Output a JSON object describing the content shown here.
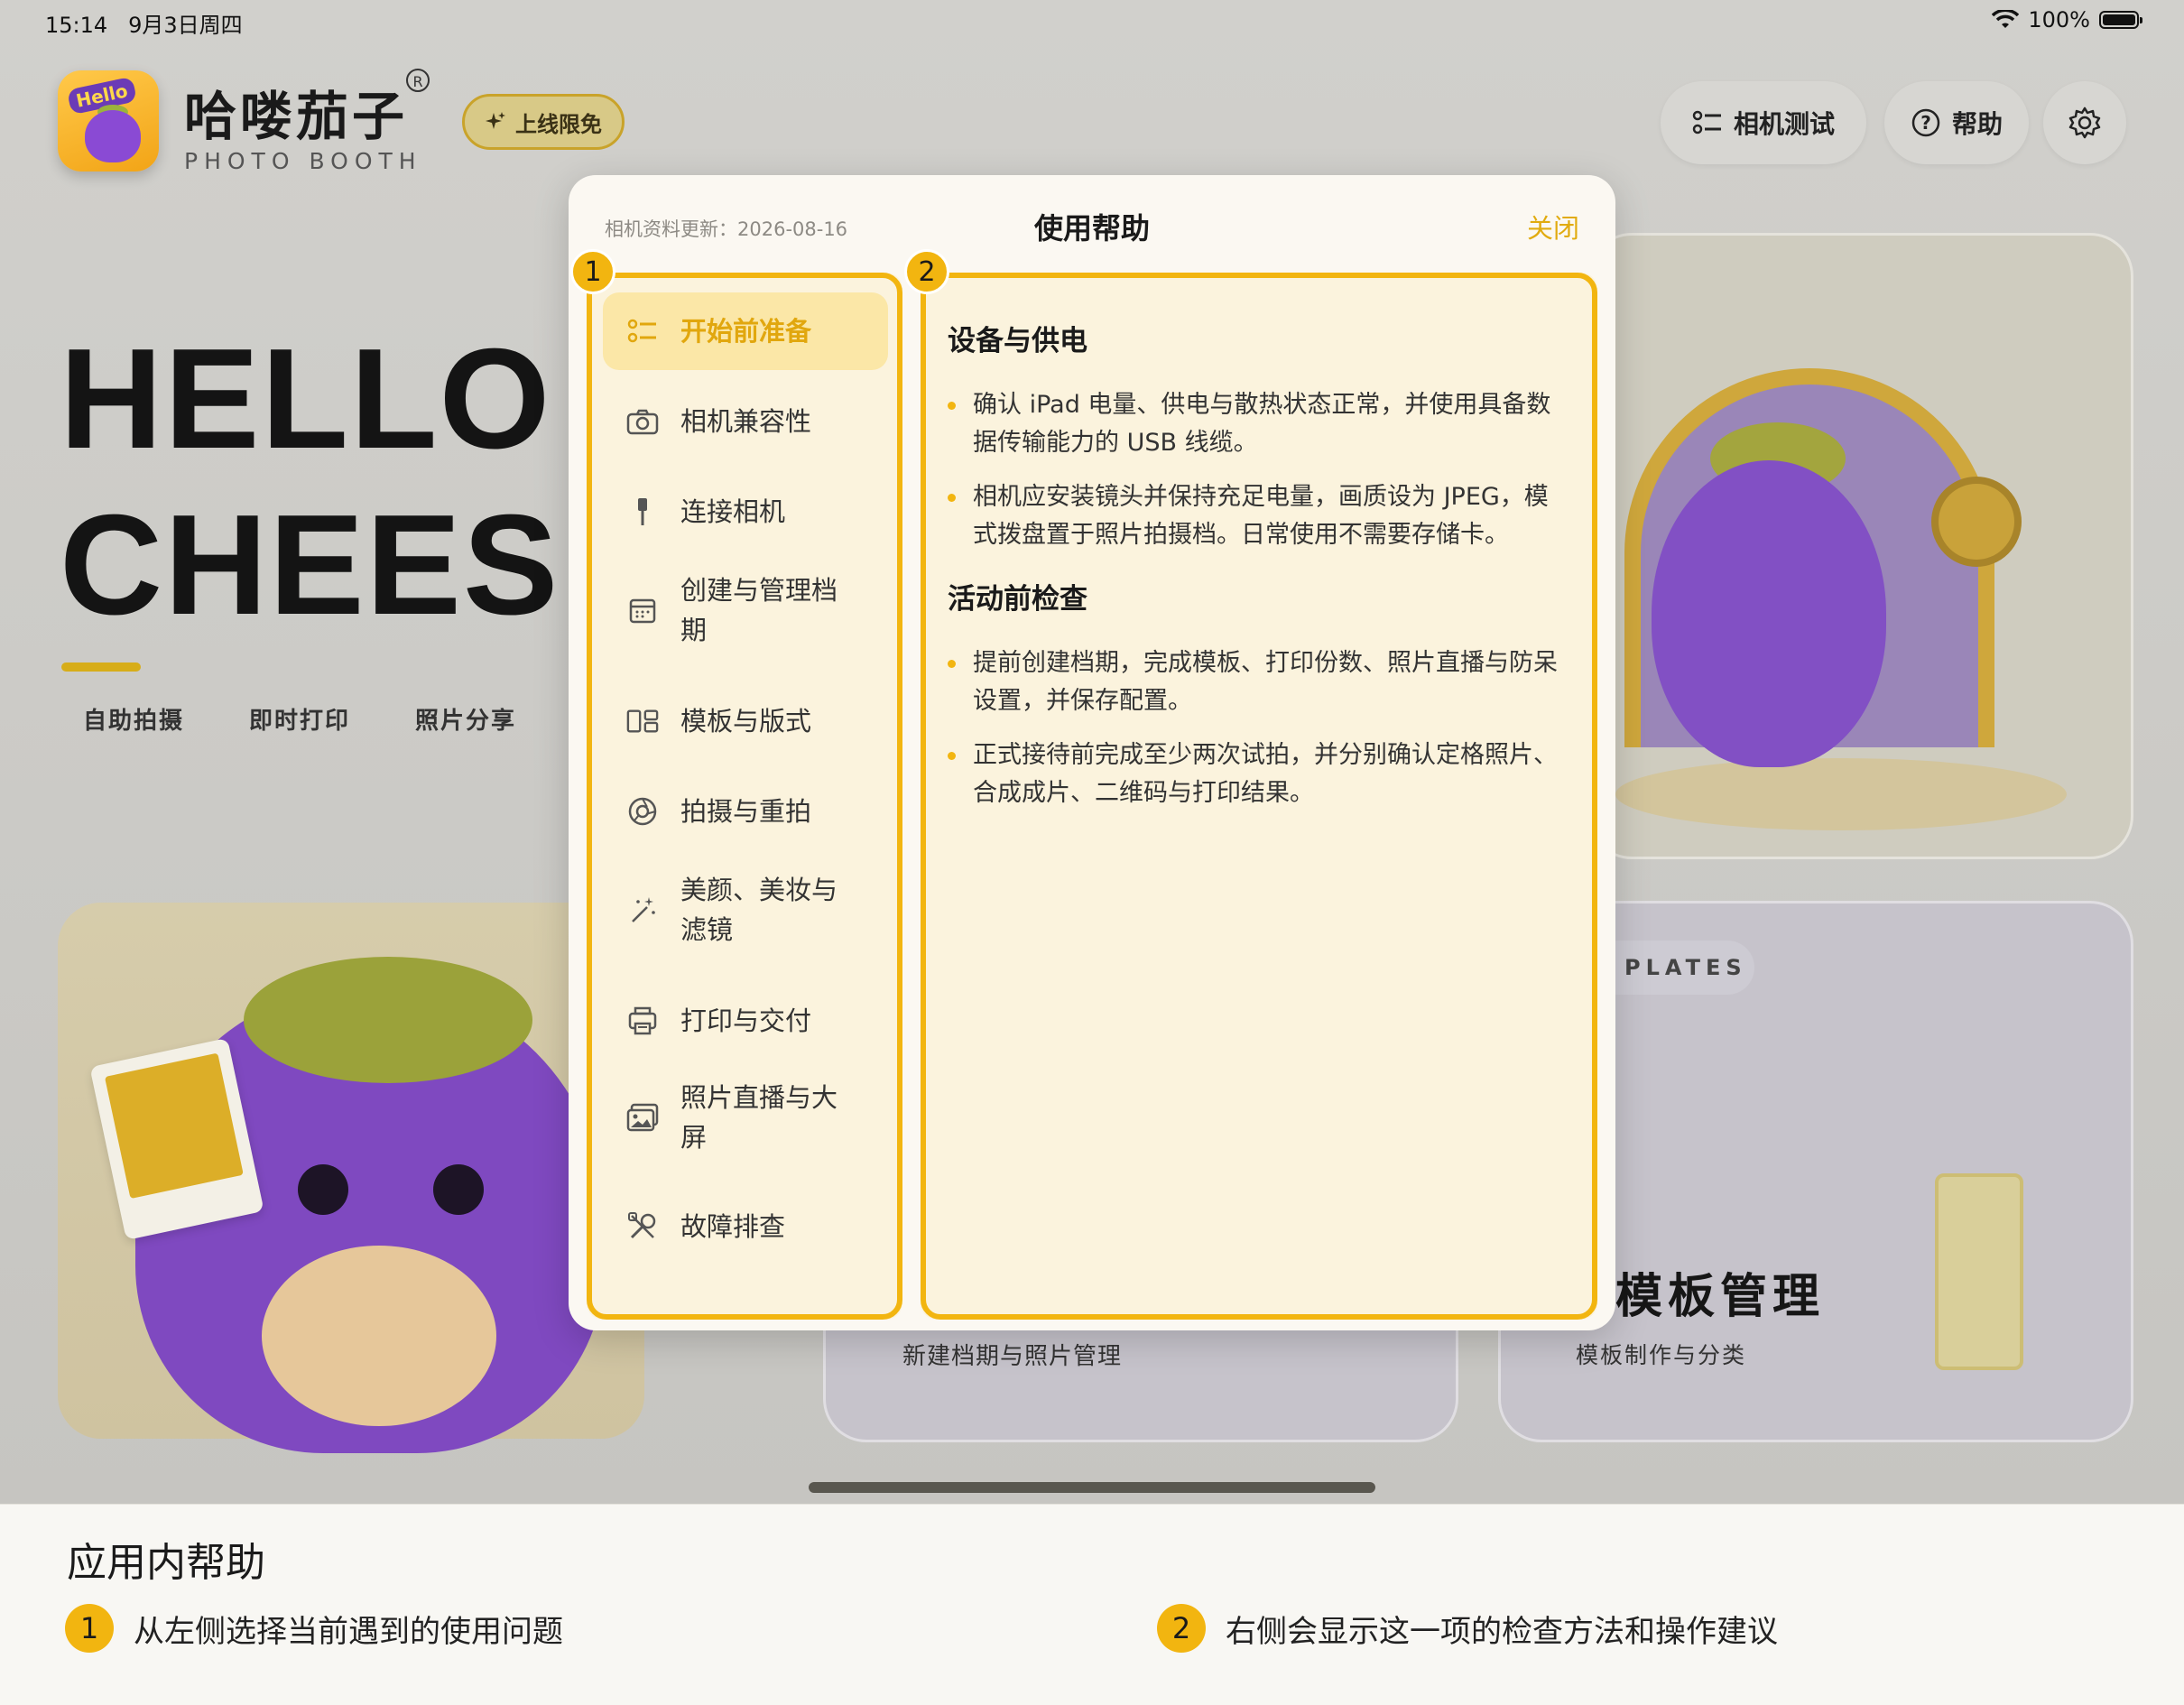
{
  "status_bar": {
    "time": "15:14",
    "date": "9月3日周四",
    "battery": "100%"
  },
  "brand": {
    "logo_text": "Hello",
    "name": "哈喽茄子",
    "registered": "R",
    "tagline": "PHOTO BOOTH",
    "promo": "上线限免"
  },
  "header_buttons": {
    "camera_test": "相机测试",
    "help": "帮助"
  },
  "hero": {
    "line1": "HELLO",
    "line2": "CHEESE",
    "features": [
      "自助拍摄",
      "即时打印",
      "照片分享"
    ]
  },
  "cards": {
    "mid_bottom_label": "新建档期与照片管理",
    "templates_pill": "PLATES",
    "templates_title": "模板管理",
    "templates_sub": "模板制作与分类"
  },
  "modal": {
    "updated": "相机资料更新：2026-08-16",
    "title": "使用帮助",
    "close": "关闭",
    "nav": [
      {
        "label": "开始前准备",
        "icon": "checklist-icon"
      },
      {
        "label": "相机兼容性",
        "icon": "camera-icon"
      },
      {
        "label": "连接相机",
        "icon": "usb-cable-icon"
      },
      {
        "label": "创建与管理档期",
        "icon": "calendar-icon"
      },
      {
        "label": "模板与版式",
        "icon": "layout-icon"
      },
      {
        "label": "拍摄与重拍",
        "icon": "aperture-icon"
      },
      {
        "label": "美颜、美妆与滤镜",
        "icon": "magic-wand-icon"
      },
      {
        "label": "打印与交付",
        "icon": "printer-icon"
      },
      {
        "label": "照片直播与大屏",
        "icon": "photos-icon"
      },
      {
        "label": "故障排查",
        "icon": "tools-icon"
      }
    ],
    "sections": [
      {
        "title": "设备与供电",
        "items": [
          "确认 iPad 电量、供电与散热状态正常，并使用具备数据传输能力的 USB 线缆。",
          "相机应安装镜头并保持充足电量，画质设为 JPEG，模式拨盘置于照片拍摄档。日常使用不需要存储卡。"
        ]
      },
      {
        "title": "活动前检查",
        "items": [
          "提前创建档期，完成模板、打印份数、照片直播与防呆设置，并保存配置。",
          "正式接待前完成至少两次试拍，并分别确认定格照片、合成成片、二维码与打印结果。"
        ]
      }
    ]
  },
  "callouts": {
    "one": "1",
    "two": "2"
  },
  "bottom": {
    "title": "应用内帮助",
    "legend1": "从左侧选择当前遇到的使用问题",
    "legend2": "右侧会显示这一项的检查方法和操作建议"
  },
  "colors": {
    "accent": "#f2b510",
    "accent_text": "#e1a70e",
    "panel_bg": "#fbf3dd",
    "modal_bg": "#fbf8f2"
  }
}
